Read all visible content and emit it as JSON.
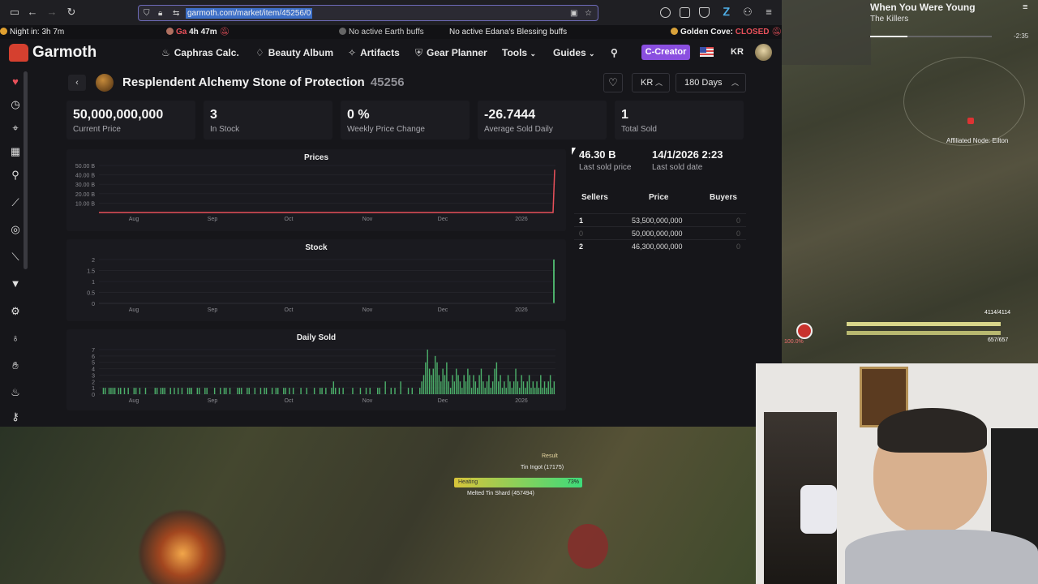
{
  "browser": {
    "url": "garmoth.com/market/item/45256/0"
  },
  "statusbar": {
    "night": "Night in: 3h 7m",
    "ga_label": "Ga",
    "ga_time": "4h 47m",
    "earth_buffs": "No active Earth buffs",
    "edana_buffs": "No active Edana's Blessing buffs",
    "golden_cove_label": "Golden Cove:",
    "golden_cove_status": "CLOSED"
  },
  "nav": {
    "logo": "Garmoth",
    "items": [
      "Caphras Calc.",
      "Beauty Album",
      "Artifacts",
      "Gear Planner",
      "Tools",
      "Guides"
    ],
    "creator": "C-Creator",
    "region": "KR"
  },
  "item": {
    "name": "Resplendent Alchemy Stone of Protection",
    "id": "45256",
    "region_select": "KR",
    "period_select": "180 Days"
  },
  "stats": [
    {
      "value": "50,000,000,000",
      "label": "Current Price"
    },
    {
      "value": "3",
      "label": "In Stock"
    },
    {
      "value": "0 %",
      "label": "Weekly Price Change"
    },
    {
      "value": "-26.7444",
      "label": "Average Sold Daily"
    },
    {
      "value": "1",
      "label": "Total Sold"
    }
  ],
  "last_sold": {
    "price": "46.30 B",
    "price_label": "Last sold price",
    "date": "14/1/2026 2:23",
    "date_label": "Last sold date"
  },
  "orders": {
    "headers": [
      "Sellers",
      "Price",
      "Buyers"
    ],
    "rows": [
      {
        "sellers": "1",
        "price": "53,500,000,000",
        "buyers": "0"
      },
      {
        "sellers": "0",
        "price": "50,000,000,000",
        "buyers": "0"
      },
      {
        "sellers": "2",
        "price": "46,300,000,000",
        "buyers": "0"
      }
    ]
  },
  "charts": {
    "months": [
      "Aug",
      "Sep",
      "Oct",
      "Nov",
      "Dec",
      "2026"
    ],
    "prices_title": "Prices",
    "stock_title": "Stock",
    "daily_title": "Daily Sold"
  },
  "chart_data": [
    {
      "type": "line",
      "title": "Prices",
      "x": [
        "Aug",
        "Sep",
        "Oct",
        "Nov",
        "Dec",
        "2026"
      ],
      "ytick_labels": [
        "10.00 B",
        "20.00 B",
        "30.00 B",
        "40.00 B",
        "50.00 B"
      ],
      "series": [
        {
          "values": [
            0,
            0,
            0,
            0,
            0,
            0,
            50
          ]
        }
      ],
      "color": "#e8505a"
    },
    {
      "type": "bar",
      "title": "Stock",
      "x": [
        "Aug",
        "Sep",
        "Oct",
        "Nov",
        "Dec",
        "2026"
      ],
      "ytick_labels": [
        "0",
        "0.5",
        "1",
        "1.5",
        "2"
      ],
      "series": [
        {
          "values": [
            0,
            0,
            0,
            0,
            0,
            0,
            2
          ]
        }
      ],
      "color": "#4caf6a"
    },
    {
      "type": "bar",
      "title": "Daily Sold",
      "x": [
        "Aug",
        "Sep",
        "Oct",
        "Nov",
        "Dec",
        "2026"
      ],
      "ytick_labels": [
        "0",
        "1",
        "2",
        "3",
        "4",
        "5",
        "6",
        "7"
      ],
      "series": [
        {
          "values": [
            0,
            0,
            1,
            1,
            0,
            1,
            1,
            1,
            1,
            0,
            1,
            1,
            0,
            1,
            0,
            1,
            0,
            0,
            1,
            1,
            0,
            1,
            0,
            0,
            1,
            0,
            0,
            0,
            0,
            1,
            1,
            0,
            1,
            1,
            1,
            0,
            0,
            1,
            0,
            1,
            0,
            1,
            0,
            1,
            0,
            0,
            1,
            1,
            1,
            0,
            0,
            1,
            1,
            0,
            0,
            1,
            1,
            0,
            0,
            0,
            1,
            0,
            0,
            1,
            0,
            1,
            1,
            0,
            1,
            0,
            0,
            0,
            1,
            1,
            1,
            0,
            0,
            1,
            1,
            0,
            0,
            1,
            0,
            0,
            1,
            0,
            1,
            1,
            0,
            0,
            1,
            0,
            1,
            1,
            0,
            0,
            1,
            1,
            0,
            1,
            0,
            1,
            0,
            0,
            0,
            1,
            0,
            0,
            1,
            0,
            0,
            0,
            1,
            0,
            0,
            1,
            1,
            0,
            1,
            0,
            0,
            1,
            2,
            1,
            0,
            1,
            0,
            1,
            0,
            0,
            0,
            0,
            1,
            0,
            0,
            0,
            1,
            0,
            0,
            1,
            0,
            1,
            0,
            0,
            0,
            1,
            1,
            0,
            0,
            2,
            0,
            0,
            1,
            0,
            1,
            0,
            0,
            2,
            0,
            0,
            0,
            1,
            0,
            1,
            0,
            0,
            0,
            1,
            2,
            3,
            5,
            7,
            4,
            3,
            4,
            6,
            5,
            3,
            2,
            4,
            3,
            5,
            2,
            1,
            3,
            2,
            4,
            3,
            2,
            1,
            3,
            2,
            4,
            3,
            1,
            3,
            2,
            1,
            3,
            4,
            2,
            1,
            2,
            3,
            1,
            2,
            4,
            5,
            2,
            3,
            1,
            2,
            1,
            3,
            2,
            1,
            2,
            4,
            2,
            1,
            3,
            2,
            1,
            2,
            3,
            1,
            2,
            1,
            2,
            1,
            3,
            1,
            2,
            1,
            2,
            3,
            1,
            2
          ]
        }
      ],
      "color": "#4caf6a"
    }
  ],
  "stream": {
    "song_title": "When You Were Young",
    "song_artist": "The Killers",
    "song_time": "-2:35",
    "node_label": "Affiliated Node: Eilton",
    "hp_text": "4114/4114",
    "sp_text": "657/657",
    "hp_percent": "100.0%",
    "craft_result": "Result",
    "craft_item": "Tin Ingot (17175)",
    "craft_action": "Heating",
    "craft_percent": "73%",
    "craft_material": "Melted Tin Shard (457494)"
  }
}
